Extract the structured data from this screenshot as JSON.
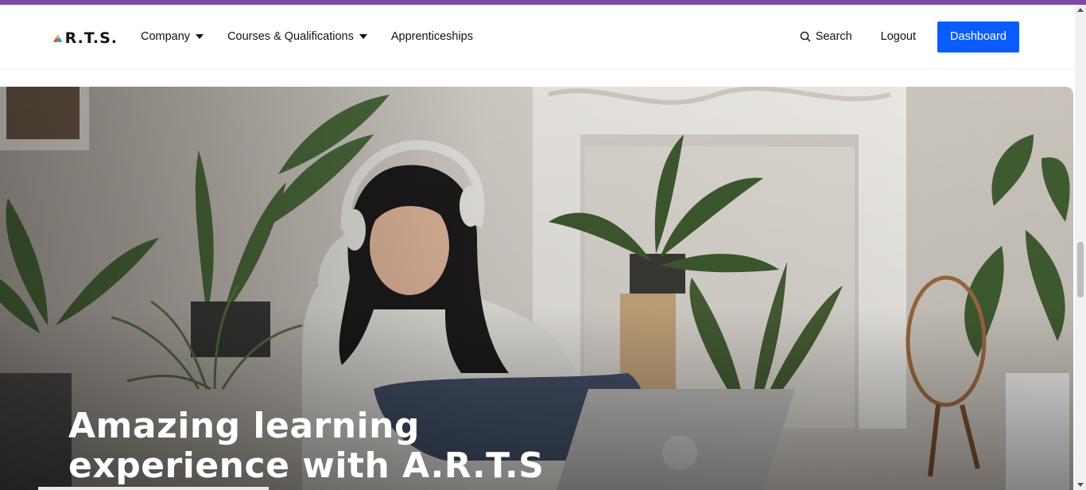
{
  "brand": {
    "name": "A.R.T.S",
    "logo_text": "R.T.S.",
    "logo_colors": [
      "#f5a623",
      "#e8413c",
      "#1e9be9"
    ]
  },
  "nav": {
    "items": [
      {
        "label": "Company",
        "has_dropdown": true
      },
      {
        "label": "Courses & Qualifications",
        "has_dropdown": true
      },
      {
        "label": "Apprenticeships",
        "has_dropdown": false
      }
    ]
  },
  "actions": {
    "search_label": "Search",
    "logout_label": "Logout",
    "dashboard_label": "Dashboard"
  },
  "hero": {
    "title_line1": "Amazing learning",
    "title_line2": "experience with A.R.T.S"
  },
  "colors": {
    "topbar": "#7a4aa8",
    "primary_button": "#0a5cff",
    "text": "#111111"
  }
}
